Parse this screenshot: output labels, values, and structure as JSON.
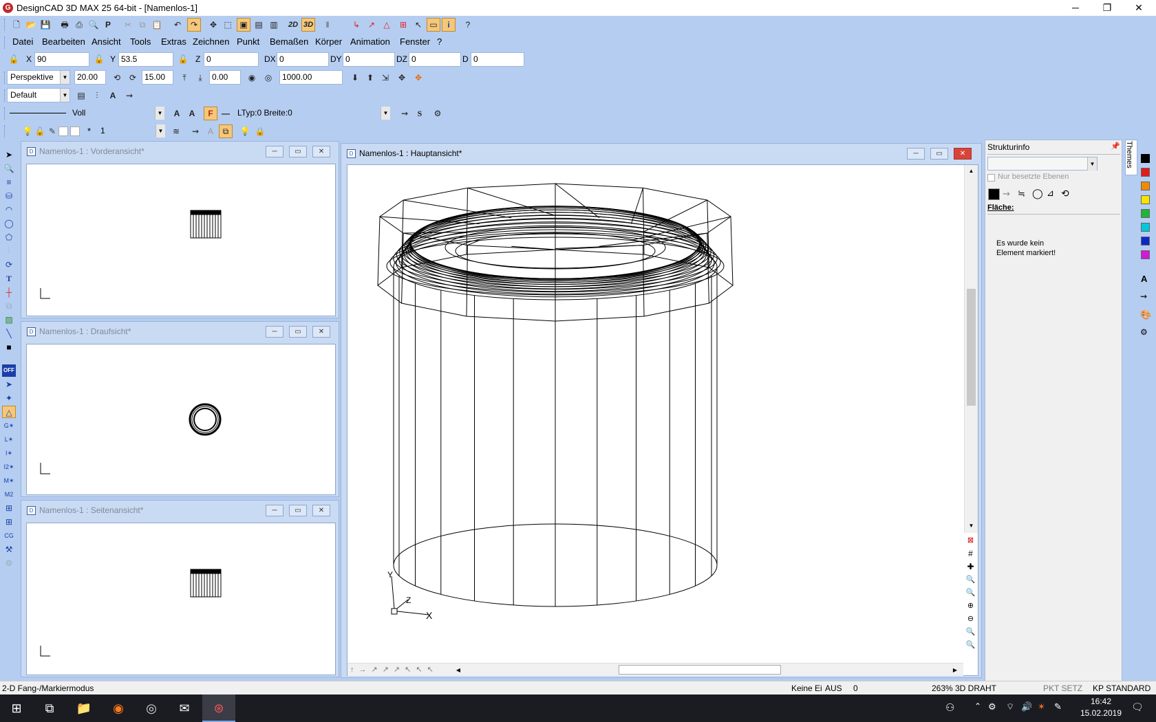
{
  "app": {
    "title": "DesignCAD 3D MAX 25 64-bit - [Namenlos-1]",
    "logo_letter": "G",
    "window_controls": {
      "minimize": "─",
      "restore": "❐",
      "close": "✕"
    }
  },
  "menu": [
    "Datei",
    "Bearbeiten",
    "Ansicht",
    "Tools",
    "Extras",
    "Zeichnen",
    "Punkt",
    "Bemaßen",
    "Körper",
    "Animation",
    "Fenster",
    "?"
  ],
  "toolbar": {
    "btn_2d": "2D",
    "btn_3d": "3D"
  },
  "coords": {
    "x_label": "X",
    "x_value": "90",
    "y_label": "Y",
    "y_value": "53.5",
    "z_label": "Z",
    "z_value": "0",
    "dx_label": "DX",
    "dx_value": "0",
    "dy_label": "DY",
    "dy_value": "0",
    "dz_label": "DZ",
    "dz_value": "0",
    "d_label": "D",
    "d_value": "0"
  },
  "view_bar": {
    "projection": "Perspektive",
    "value1": "20.00",
    "value2": "15.00",
    "value3": "0.00",
    "value4": "1000.00"
  },
  "style_bar": {
    "preset": "Default"
  },
  "line_bar": {
    "line_style": "Voll",
    "fill_letter": "F",
    "ltype": "LTyp:0  Breite:0"
  },
  "layer_bar": {
    "star": "*",
    "layer": "1"
  },
  "windows": [
    {
      "title": "Namenlos-1 : Vorderansicht*"
    },
    {
      "title": "Namenlos-1 : Draufsicht*"
    },
    {
      "title": "Namenlos-1 : Seitenansicht*"
    },
    {
      "title": "Namenlos-1 : Hauptansicht*"
    }
  ],
  "main_view": {
    "axis_x": "X",
    "axis_y": "Y",
    "axis_z": "Z"
  },
  "struct_panel": {
    "title": "Strukturinfo",
    "checkbox_label": "Nur besetzte Ebenen",
    "surface_label": "Fläche:",
    "message_line1": "Es wurde kein",
    "message_line2": "Element markiert!",
    "themes_tab": "Themes"
  },
  "palette_colors": [
    "#000000",
    "#e11b1b",
    "#f08a00",
    "#f7e400",
    "#1fb43a",
    "#00c9d8",
    "#0a28c8",
    "#d11ad6"
  ],
  "status": {
    "mode": "2-D Fang-/Markiermodus",
    "keine": "Keine Ei",
    "aus": "AUS",
    "zero": "0",
    "zoom": "263%",
    "render": "3D DRAHT",
    "pkt": "PKT SETZ",
    "kp": "KP STANDARD"
  },
  "taskbar": {
    "time": "16:42",
    "date": "15.02.2019"
  }
}
